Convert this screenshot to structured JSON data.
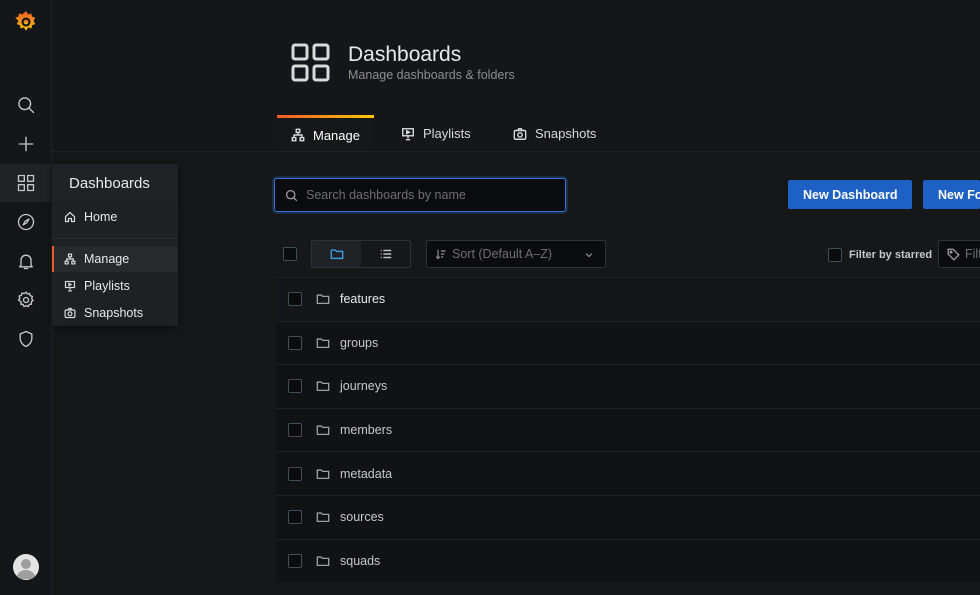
{
  "colors": {
    "accent": "#1f60c4",
    "brand_orange": "#f05a28",
    "focus_blue": "#3274d9"
  },
  "sidebar": {
    "icons": [
      "grafana-logo-icon",
      "search-icon",
      "plus-icon",
      "dashboards-icon",
      "explore-compass-icon",
      "alerting-bell-icon",
      "configuration-gear-icon",
      "shield-icon",
      "user-avatar"
    ]
  },
  "flyout": {
    "title": "Dashboards",
    "items": [
      {
        "label": "Home",
        "icon": "home-icon"
      },
      {
        "label": "Manage",
        "icon": "sitemap-icon"
      },
      {
        "label": "Playlists",
        "icon": "presentation-icon"
      },
      {
        "label": "Snapshots",
        "icon": "camera-icon"
      }
    ]
  },
  "header": {
    "title": "Dashboards",
    "subtitle": "Manage dashboards & folders"
  },
  "tabs": [
    {
      "label": "Manage",
      "icon": "sitemap-icon",
      "active": true
    },
    {
      "label": "Playlists",
      "icon": "presentation-icon",
      "active": false
    },
    {
      "label": "Snapshots",
      "icon": "camera-icon",
      "active": false
    }
  ],
  "search": {
    "placeholder": "Search dashboards by name"
  },
  "actions": {
    "new_dashboard": "New Dashboard",
    "new_folder": "New Fo"
  },
  "toolbar": {
    "sort_placeholder": "Sort (Default A–Z)",
    "filter_starred_label": "Filter by starred",
    "tag_filter_placeholder": "Filt"
  },
  "folders": [
    "features",
    "groups",
    "journeys",
    "members",
    "metadata",
    "sources",
    "squads"
  ]
}
